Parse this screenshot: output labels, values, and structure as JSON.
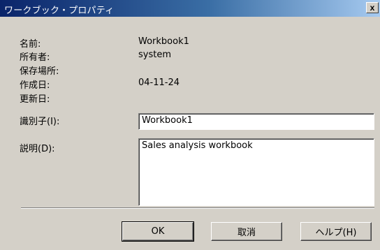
{
  "window": {
    "title": "ワークブック・プロパティ",
    "close_glyph": "x"
  },
  "info": {
    "name_label": "名前:",
    "name_value": "Workbook1",
    "owner_label": "所有者:",
    "owner_value": "system",
    "location_label": "保存場所:",
    "location_value": "",
    "created_label": "作成日:",
    "created_value": "04-11-24",
    "modified_label": "更新日:",
    "modified_value": ""
  },
  "fields": {
    "identifier_label": "識別子(I):",
    "identifier_value": "Workbook1",
    "description_label": "説明(D):",
    "description_value": "Sales analysis workbook"
  },
  "buttons": {
    "ok": "OK",
    "cancel": "取消",
    "help": "ヘルプ(H)"
  },
  "colors": {
    "title_start": "#0a246a",
    "title_end": "#a6caf0",
    "dialog_face": "#d4d0c8"
  }
}
